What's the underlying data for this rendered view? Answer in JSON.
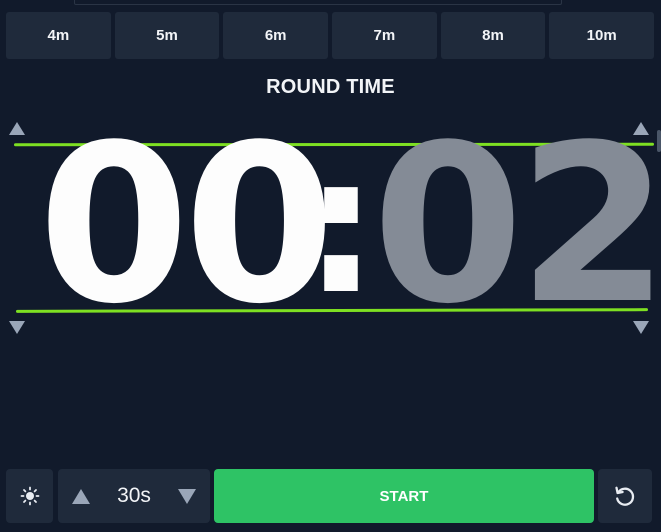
{
  "presets": [
    "4m",
    "5m",
    "6m",
    "7m",
    "8m",
    "10m"
  ],
  "title": "ROUND TIME",
  "timer": {
    "minutes": "00",
    "separator": ":",
    "seconds": "02"
  },
  "controls": {
    "interval_value": "30s",
    "start_label": "START"
  },
  "icons": {
    "brightness": "sun-icon",
    "reset": "reset-icon",
    "increment": "up-triangle-icon",
    "decrement": "down-triangle-icon"
  },
  "colors": {
    "background": "#111a2b",
    "button": "#1f2a3b",
    "start": "#2ec365",
    "guide_line": "#7ee022",
    "minutes_digits": "#fdfdfd",
    "seconds_digits": "#848b96",
    "arrow": "#9aa6b8"
  }
}
